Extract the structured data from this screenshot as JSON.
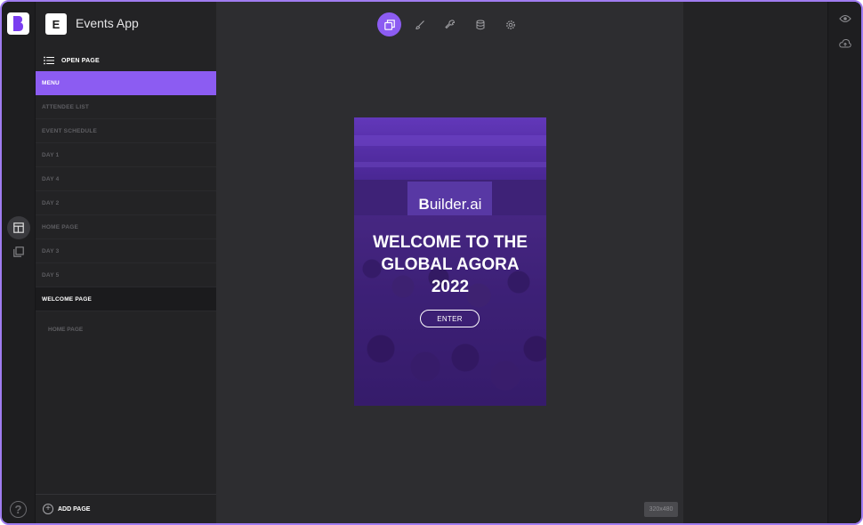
{
  "app": {
    "logo_letter": "B",
    "title": "Events App",
    "icon_letter": "E"
  },
  "panel": {
    "open_page_label": "OPEN PAGE",
    "pages": [
      {
        "label": "MENU",
        "state": "active"
      },
      {
        "label": "ATTENDEE LIST",
        "state": "normal"
      },
      {
        "label": "EVENT SCHEDULE",
        "state": "normal"
      },
      {
        "label": "DAY 1",
        "state": "normal"
      },
      {
        "label": "DAY 4",
        "state": "normal"
      },
      {
        "label": "DAY 2",
        "state": "normal"
      },
      {
        "label": "HOME PAGE",
        "state": "normal"
      },
      {
        "label": "DAY 3",
        "state": "normal"
      },
      {
        "label": "DAY 5",
        "state": "normal"
      },
      {
        "label": "WELCOME PAGE",
        "state": "selected"
      }
    ],
    "sub_item": "HOME PAGE",
    "add_page_label": "ADD PAGE"
  },
  "toolbar": {
    "tools": [
      "layers-icon",
      "brush-icon",
      "wrench-icon",
      "database-icon",
      "gear-icon"
    ],
    "active": "layers-icon"
  },
  "preview": {
    "logo_prefix": "B",
    "logo_text": "uilder.ai",
    "heading_line1": "WELCOME TO THE",
    "heading_line2": "GLOBAL AGORA",
    "heading_line3": "2022",
    "button_label": "ENTER",
    "size_label": "320x480"
  },
  "help_label": "?",
  "colors": {
    "accent": "#8c5cf2",
    "frame_border": "#a07cf0",
    "panel_bg": "#232325",
    "canvas_bg": "#2d2d30"
  }
}
